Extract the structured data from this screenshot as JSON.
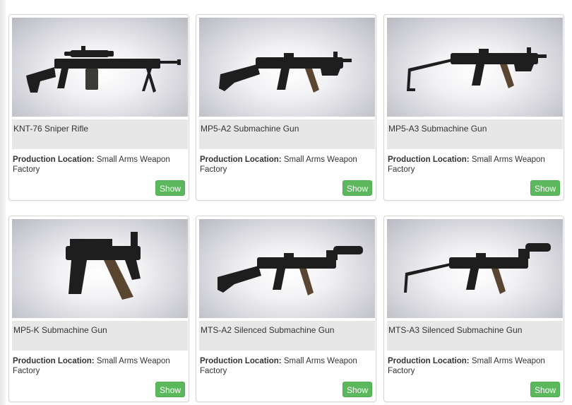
{
  "products": [
    {
      "name": "KNT-76 Sniper Rifle",
      "location_label": "Production Location:",
      "location_value": "Small Arms Weapon Factory",
      "button": "Show"
    },
    {
      "name": "MP5-A2 Submachine Gun",
      "location_label": "Production Location:",
      "location_value": "Small Arms Weapon Factory",
      "button": "Show"
    },
    {
      "name": "MP5-A3 Submachine Gun",
      "location_label": "Production Location:",
      "location_value": "Small Arms Weapon Factory",
      "button": "Show"
    },
    {
      "name": "MP5-K Submachine Gun",
      "location_label": "Production Location:",
      "location_value": "Small Arms Weapon Factory",
      "button": "Show"
    },
    {
      "name": "MTS-A2 Silenced Submachine Gun",
      "location_label": "Production Location:",
      "location_value": "Small Arms Weapon Factory",
      "button": "Show"
    },
    {
      "name": "MTS-A3 Silenced Submachine Gun",
      "location_label": "Production Location:",
      "location_value": "Small Arms Weapon Factory",
      "button": "Show"
    }
  ],
  "colors": {
    "button_green": "#5cb85c",
    "title_bar_gray": "#e7e7e7",
    "card_border": "#d6d6d6"
  }
}
